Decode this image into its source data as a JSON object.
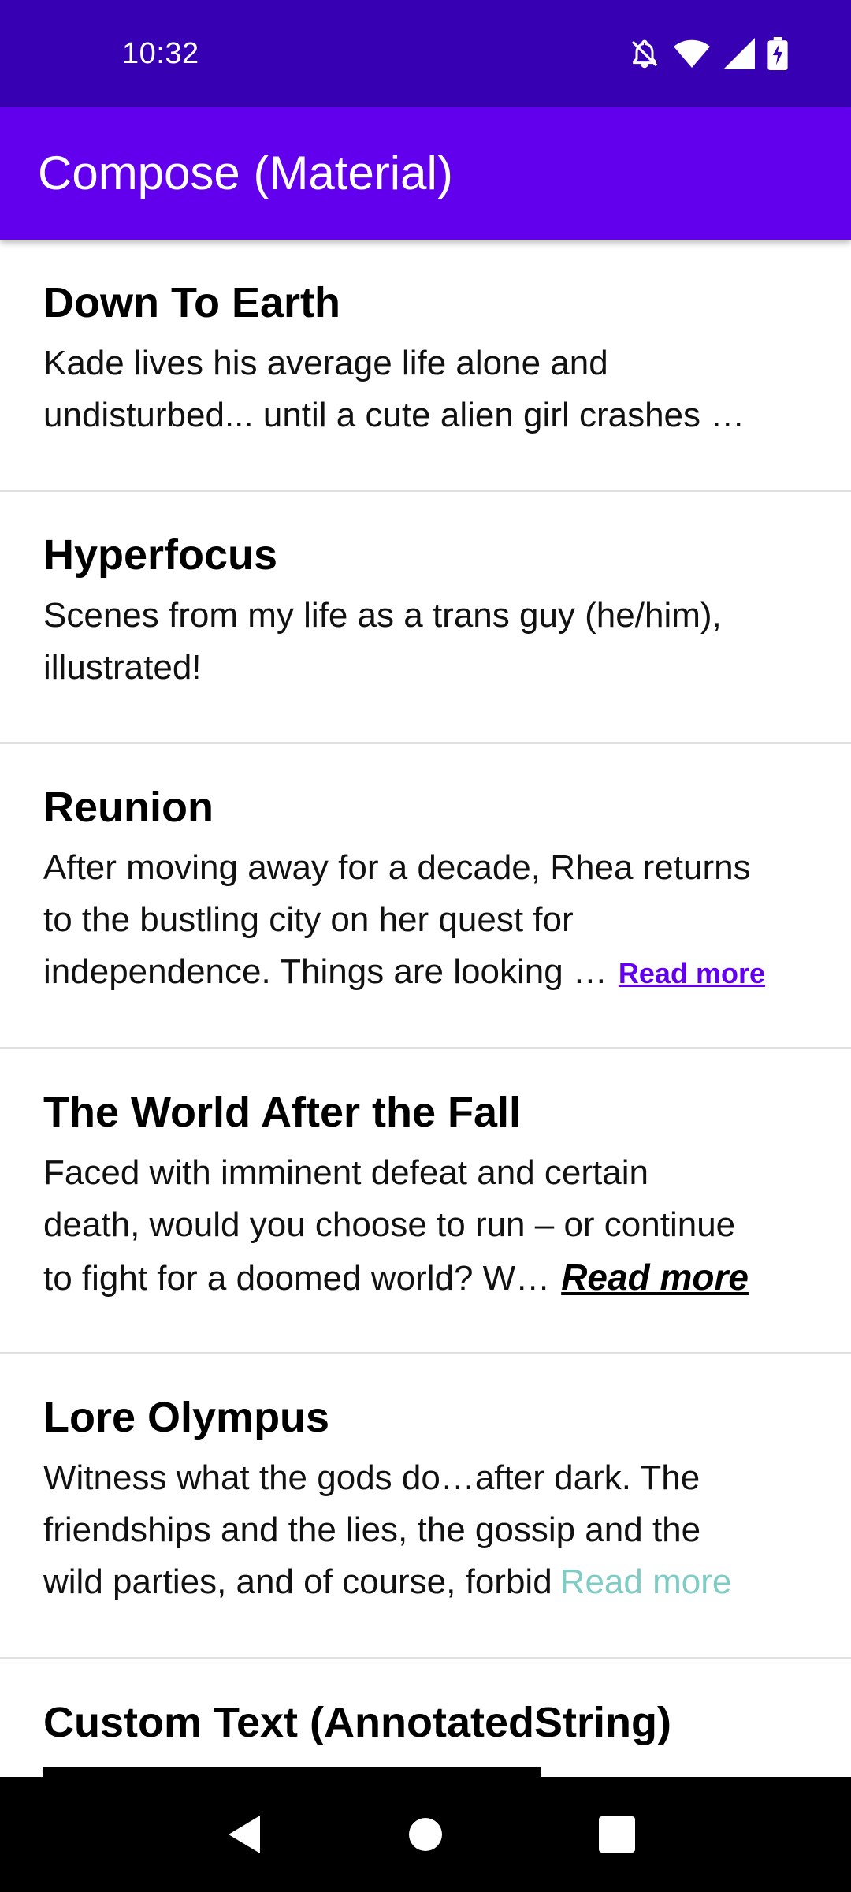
{
  "status_bar": {
    "time": "10:32",
    "icons": [
      "notifications-off-icon",
      "wifi-icon",
      "cell-signal-icon",
      "battery-charging-icon"
    ]
  },
  "app_bar": {
    "title": "Compose (Material)"
  },
  "items": [
    {
      "title": "Down To Earth",
      "lines": [
        "Kade lives his average life alone and",
        "undisturbed... until a cute alien girl crashes …"
      ]
    },
    {
      "title": "Hyperfocus",
      "lines": [
        "Scenes from my life as a trans guy (he/him),",
        "illustrated!"
      ]
    },
    {
      "title": "Reunion",
      "lines": [
        "After moving away for a decade, Rhea returns",
        "to the bustling city on her quest for",
        "independence. Things are looking …"
      ],
      "read_more": "Read more"
    },
    {
      "title": "The World After the Fall",
      "lines": [
        "Faced with imminent defeat and certain",
        "death, would you choose to run – or continue",
        "to fight for a doomed world? W…"
      ],
      "read_more": "Read more"
    },
    {
      "title": "Lore Olympus",
      "lines": [
        "Witness what the gods do…after dark. The",
        "friendships and the lies, the gossip and the",
        "wild parties, and of course, forbid"
      ],
      "read_more": "Read more"
    },
    {
      "title": "Custom Text (AnnotatedString)"
    }
  ],
  "colors": {
    "status_bar": "#3700B3",
    "app_bar": "#6200EE",
    "read_more_primary": "#6200EE",
    "read_more_teal": "#80CBC4",
    "divider": "#E0E0E0",
    "nav_bar": "#000000"
  },
  "nav_bar": {
    "icons": [
      "back-icon",
      "home-icon",
      "recents-icon"
    ]
  }
}
